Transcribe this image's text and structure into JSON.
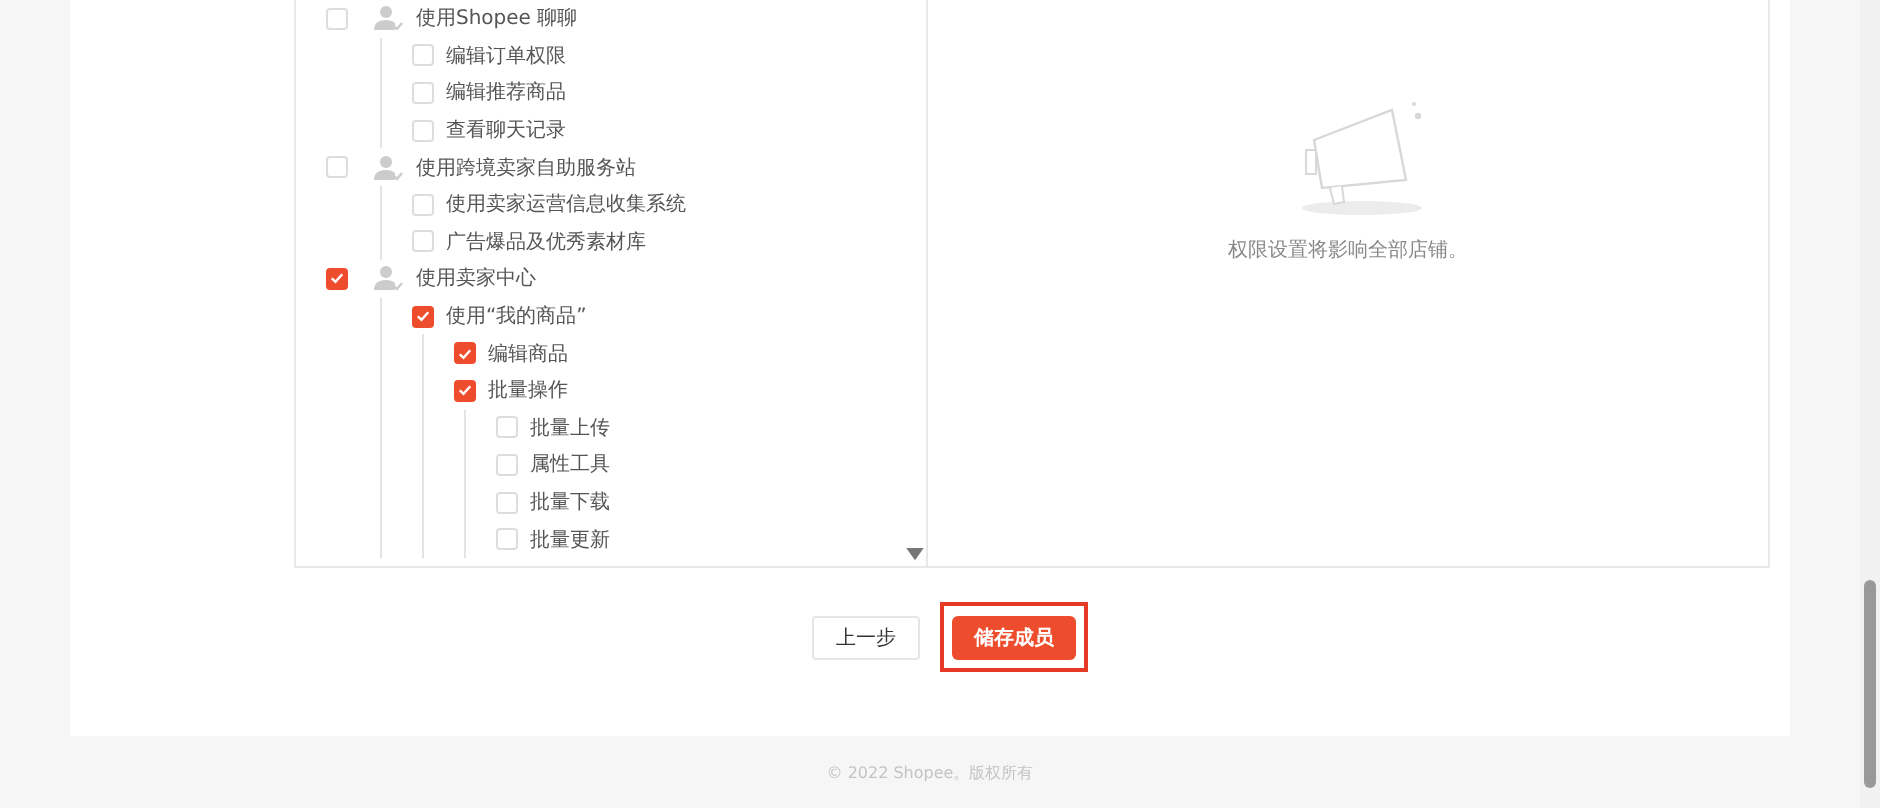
{
  "permissions": [
    {
      "label": "使用Shopee 聊聊",
      "checked": false,
      "children": [
        {
          "label": "编辑订单权限",
          "checked": false
        },
        {
          "label": "编辑推荐商品",
          "checked": false
        },
        {
          "label": "查看聊天记录",
          "checked": false
        }
      ]
    },
    {
      "label": "使用跨境卖家自助服务站",
      "checked": false,
      "children": [
        {
          "label": "使用卖家运营信息收集系统",
          "checked": false
        },
        {
          "label": "广告爆品及优秀素材库",
          "checked": false
        }
      ]
    },
    {
      "label": "使用卖家中心",
      "checked": true,
      "children": [
        {
          "label": "使用“我的商品”",
          "checked": true,
          "children": [
            {
              "label": "编辑商品",
              "checked": true
            },
            {
              "label": "批量操作",
              "checked": true,
              "children": [
                {
                  "label": "批量上传",
                  "checked": false
                },
                {
                  "label": "属性工具",
                  "checked": false
                },
                {
                  "label": "批量下载",
                  "checked": false
                },
                {
                  "label": "批量更新",
                  "checked": false
                }
              ]
            }
          ]
        }
      ]
    }
  ],
  "notice": "权限设置将影响全部店铺。",
  "buttons": {
    "back": "上一步",
    "save": "储存成员"
  },
  "footer": "© 2022 Shopee。版权所有"
}
